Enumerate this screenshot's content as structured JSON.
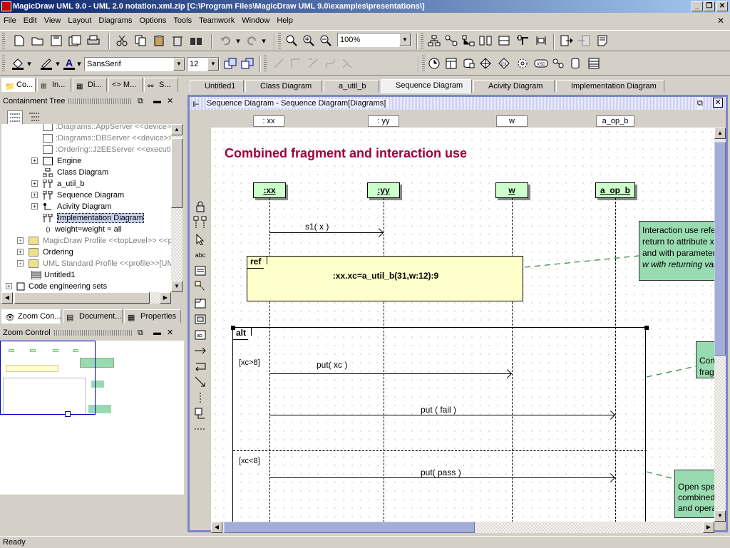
{
  "window": {
    "title": "MagicDraw UML 9.0 - UML 2.0 notation.xml.zip [C:\\Program Files\\MagicDraw UML 9.0\\examples\\presentations\\]"
  },
  "menu": [
    "File",
    "Edit",
    "View",
    "Layout",
    "Diagrams",
    "Options",
    "Tools",
    "Teamwork",
    "Window",
    "Help"
  ],
  "toolbar": {
    "zoom": "100%",
    "font": "SansSerif",
    "font_size": "12"
  },
  "left_tabs": [
    "Co...",
    "In...",
    "Di...",
    "<> M...",
    "S..."
  ],
  "containment": {
    "title": "Containment Tree",
    "items": [
      {
        "text": ":Diagrams::AppServer",
        "suffix": "<<device>>",
        "gray": true
      },
      {
        "text": ":Diagrams::DBServer",
        "suffix": "<<device>>",
        "gray": true
      },
      {
        "text": ":Ordering::J2EEServer",
        "suffix": "<<executi",
        "gray": true
      },
      {
        "text": "Engine",
        "suffix": "",
        "gray": false
      },
      {
        "text": "Class Diagram",
        "suffix": "",
        "gray": false
      },
      {
        "text": "a_util_b",
        "suffix": "",
        "gray": false
      },
      {
        "text": "Sequence Diagram",
        "suffix": "",
        "gray": false
      },
      {
        "text": "Acivity Diagram",
        "suffix": "",
        "gray": false
      },
      {
        "text": "Implementation Diagram",
        "suffix": "",
        "gray": false
      },
      {
        "text": "weight=weight = all",
        "suffix": "",
        "gray": false
      },
      {
        "text": "MagicDraw Profile <<topLevel>> <<pr",
        "suffix": "",
        "gray": true
      },
      {
        "text": "Ordering",
        "suffix": "",
        "gray": false
      },
      {
        "text": "UML Standard Profile <<profile>>[UML",
        "suffix": "",
        "gray": true
      },
      {
        "text": "Untitled1",
        "suffix": "",
        "gray": false
      },
      {
        "text": "Code engineering sets",
        "suffix": "",
        "gray": false
      }
    ]
  },
  "bottom_tabs": [
    "Zoom Con...",
    "Document...",
    "Properties"
  ],
  "zoom_panel": {
    "title": "Zoom Control"
  },
  "diagram_tabs": [
    "Untitled1",
    "Class Diagram",
    "a_util_b",
    "Sequence Diagram",
    "Acivity Diagram",
    "Implementation Diagram"
  ],
  "diagram": {
    "window_title": "Sequence Diagram - Sequence Diagram[Diagrams]",
    "heading": "Combined fragment and interaction use",
    "column_headers": [
      ": xx",
      ": yy",
      "w",
      "a_op_b"
    ],
    "lifelines": [
      ":xx",
      ":yy",
      "w",
      "a_op_b"
    ],
    "messages": [
      "s1( x )",
      "put( xc )",
      "put ( fail )",
      "put( pass )"
    ],
    "ref": {
      "label": "ref",
      "text": ":xx.xc=a_util_b(31,w:12):9"
    },
    "alt": {
      "label": "alt",
      "guard1": "[xc>8]",
      "guard2": "[xc<8]"
    },
    "notes": [
      {
        "lines": [
          "Interaction use refe",
          "return to attribute xc",
          "and with parameter",
          "w with returning valu"
        ]
      },
      {
        "lines": [
          "Com",
          "frag"
        ]
      },
      {
        "lines": [
          "Open spec",
          "combined",
          "and opera"
        ]
      }
    ]
  },
  "status": {
    "text": "Ready"
  },
  "colors": {
    "title_start": "#0a246a",
    "heading": "#a0003c",
    "lifeline_fill": "#ccffcc",
    "note_fill": "#99dbb0",
    "ref_fill": "#ffffcc"
  }
}
